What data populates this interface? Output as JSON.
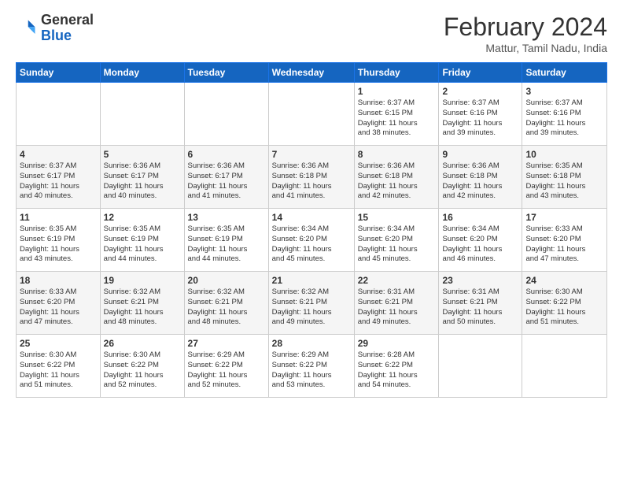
{
  "logo": {
    "general": "General",
    "blue": "Blue"
  },
  "header": {
    "title": "February 2024",
    "subtitle": "Mattur, Tamil Nadu, India"
  },
  "weekdays": [
    "Sunday",
    "Monday",
    "Tuesday",
    "Wednesday",
    "Thursday",
    "Friday",
    "Saturday"
  ],
  "weeks": [
    [
      {
        "day": "",
        "info": ""
      },
      {
        "day": "",
        "info": ""
      },
      {
        "day": "",
        "info": ""
      },
      {
        "day": "",
        "info": ""
      },
      {
        "day": "1",
        "info": "Sunrise: 6:37 AM\nSunset: 6:15 PM\nDaylight: 11 hours\nand 38 minutes."
      },
      {
        "day": "2",
        "info": "Sunrise: 6:37 AM\nSunset: 6:16 PM\nDaylight: 11 hours\nand 39 minutes."
      },
      {
        "day": "3",
        "info": "Sunrise: 6:37 AM\nSunset: 6:16 PM\nDaylight: 11 hours\nand 39 minutes."
      }
    ],
    [
      {
        "day": "4",
        "info": "Sunrise: 6:37 AM\nSunset: 6:17 PM\nDaylight: 11 hours\nand 40 minutes."
      },
      {
        "day": "5",
        "info": "Sunrise: 6:36 AM\nSunset: 6:17 PM\nDaylight: 11 hours\nand 40 minutes."
      },
      {
        "day": "6",
        "info": "Sunrise: 6:36 AM\nSunset: 6:17 PM\nDaylight: 11 hours\nand 41 minutes."
      },
      {
        "day": "7",
        "info": "Sunrise: 6:36 AM\nSunset: 6:18 PM\nDaylight: 11 hours\nand 41 minutes."
      },
      {
        "day": "8",
        "info": "Sunrise: 6:36 AM\nSunset: 6:18 PM\nDaylight: 11 hours\nand 42 minutes."
      },
      {
        "day": "9",
        "info": "Sunrise: 6:36 AM\nSunset: 6:18 PM\nDaylight: 11 hours\nand 42 minutes."
      },
      {
        "day": "10",
        "info": "Sunrise: 6:35 AM\nSunset: 6:18 PM\nDaylight: 11 hours\nand 43 minutes."
      }
    ],
    [
      {
        "day": "11",
        "info": "Sunrise: 6:35 AM\nSunset: 6:19 PM\nDaylight: 11 hours\nand 43 minutes."
      },
      {
        "day": "12",
        "info": "Sunrise: 6:35 AM\nSunset: 6:19 PM\nDaylight: 11 hours\nand 44 minutes."
      },
      {
        "day": "13",
        "info": "Sunrise: 6:35 AM\nSunset: 6:19 PM\nDaylight: 11 hours\nand 44 minutes."
      },
      {
        "day": "14",
        "info": "Sunrise: 6:34 AM\nSunset: 6:20 PM\nDaylight: 11 hours\nand 45 minutes."
      },
      {
        "day": "15",
        "info": "Sunrise: 6:34 AM\nSunset: 6:20 PM\nDaylight: 11 hours\nand 45 minutes."
      },
      {
        "day": "16",
        "info": "Sunrise: 6:34 AM\nSunset: 6:20 PM\nDaylight: 11 hours\nand 46 minutes."
      },
      {
        "day": "17",
        "info": "Sunrise: 6:33 AM\nSunset: 6:20 PM\nDaylight: 11 hours\nand 47 minutes."
      }
    ],
    [
      {
        "day": "18",
        "info": "Sunrise: 6:33 AM\nSunset: 6:20 PM\nDaylight: 11 hours\nand 47 minutes."
      },
      {
        "day": "19",
        "info": "Sunrise: 6:32 AM\nSunset: 6:21 PM\nDaylight: 11 hours\nand 48 minutes."
      },
      {
        "day": "20",
        "info": "Sunrise: 6:32 AM\nSunset: 6:21 PM\nDaylight: 11 hours\nand 48 minutes."
      },
      {
        "day": "21",
        "info": "Sunrise: 6:32 AM\nSunset: 6:21 PM\nDaylight: 11 hours\nand 49 minutes."
      },
      {
        "day": "22",
        "info": "Sunrise: 6:31 AM\nSunset: 6:21 PM\nDaylight: 11 hours\nand 49 minutes."
      },
      {
        "day": "23",
        "info": "Sunrise: 6:31 AM\nSunset: 6:21 PM\nDaylight: 11 hours\nand 50 minutes."
      },
      {
        "day": "24",
        "info": "Sunrise: 6:30 AM\nSunset: 6:22 PM\nDaylight: 11 hours\nand 51 minutes."
      }
    ],
    [
      {
        "day": "25",
        "info": "Sunrise: 6:30 AM\nSunset: 6:22 PM\nDaylight: 11 hours\nand 51 minutes."
      },
      {
        "day": "26",
        "info": "Sunrise: 6:30 AM\nSunset: 6:22 PM\nDaylight: 11 hours\nand 52 minutes."
      },
      {
        "day": "27",
        "info": "Sunrise: 6:29 AM\nSunset: 6:22 PM\nDaylight: 11 hours\nand 52 minutes."
      },
      {
        "day": "28",
        "info": "Sunrise: 6:29 AM\nSunset: 6:22 PM\nDaylight: 11 hours\nand 53 minutes."
      },
      {
        "day": "29",
        "info": "Sunrise: 6:28 AM\nSunset: 6:22 PM\nDaylight: 11 hours\nand 54 minutes."
      },
      {
        "day": "",
        "info": ""
      },
      {
        "day": "",
        "info": ""
      }
    ]
  ]
}
